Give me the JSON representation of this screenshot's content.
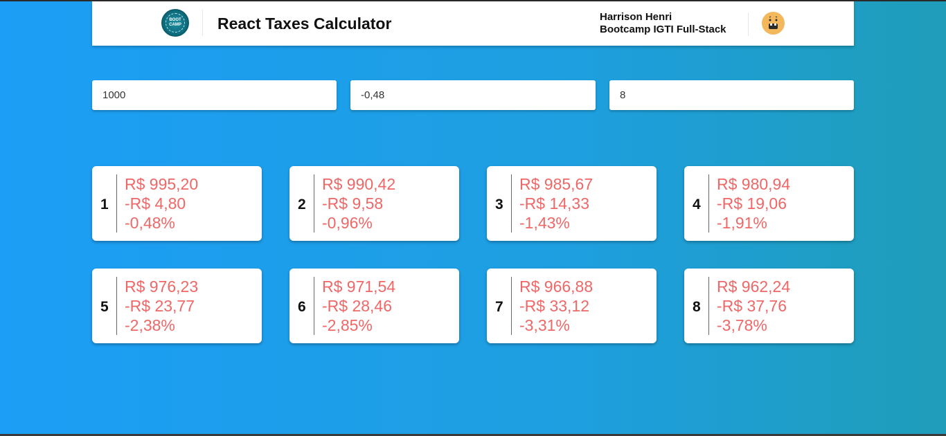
{
  "header": {
    "logo_text": "BOOT CAMP",
    "title": "React Taxes Calculator",
    "author_name": "Harrison Henri",
    "author_subtitle": "Bootcamp IGTI Full-Stack",
    "icons": {
      "logo": "bootcamp-logo-icon",
      "avatar": "emoji-avatar-icon"
    }
  },
  "inputs": {
    "initial_value": "1000",
    "monthly_rate": "-0,48",
    "months": "8"
  },
  "colors": {
    "value_text": "#f06767",
    "background_start": "#1c9ef6",
    "background_end": "#1f9db9"
  },
  "installments": [
    {
      "number": "1",
      "amount": "R$ 995,20",
      "difference": "-R$ 4,80",
      "percent": "-0,48%"
    },
    {
      "number": "2",
      "amount": "R$ 990,42",
      "difference": "-R$ 9,58",
      "percent": "-0,96%"
    },
    {
      "number": "3",
      "amount": "R$ 985,67",
      "difference": "-R$ 14,33",
      "percent": "-1,43%"
    },
    {
      "number": "4",
      "amount": "R$ 980,94",
      "difference": "-R$ 19,06",
      "percent": "-1,91%"
    },
    {
      "number": "5",
      "amount": "R$ 976,23",
      "difference": "-R$ 23,77",
      "percent": "-2,38%"
    },
    {
      "number": "6",
      "amount": "R$ 971,54",
      "difference": "-R$ 28,46",
      "percent": "-2,85%"
    },
    {
      "number": "7",
      "amount": "R$ 966,88",
      "difference": "-R$ 33,12",
      "percent": "-3,31%"
    },
    {
      "number": "8",
      "amount": "R$ 962,24",
      "difference": "-R$ 37,76",
      "percent": "-3,78%"
    }
  ]
}
